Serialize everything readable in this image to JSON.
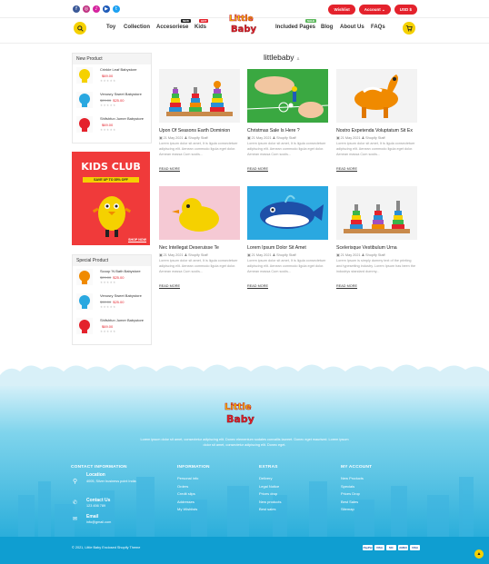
{
  "topbar": {
    "social": [
      {
        "icon": "facebook-icon",
        "glyph": "f",
        "color": "#3b5998"
      },
      {
        "icon": "instagram-icon",
        "glyph": "◎",
        "color": "#c13584"
      },
      {
        "icon": "tiktok-icon",
        "glyph": "♪",
        "color": "#d6249f"
      },
      {
        "icon": "youtube-icon",
        "glyph": "▶",
        "color": "#1e5bb8"
      },
      {
        "icon": "twitter-icon",
        "glyph": "t",
        "color": "#1da1f2"
      }
    ],
    "wishlist": "Wishlist",
    "account": "Account ⌄",
    "currency": "USD $"
  },
  "nav": {
    "toy": "Toy",
    "collection": "Collection",
    "accessories": "Accesoriese",
    "accessories_badge": "NEW",
    "kids": "Kids",
    "kids_badge": "HOT",
    "included_pages": "Included Pages",
    "included_badge": "SALE",
    "blog": "Blog",
    "about": "About Us",
    "faqs": "FAQs",
    "logo_line1": "Little",
    "logo_line2": "Baby",
    "cart_count": "0"
  },
  "sidebar": {
    "new_title": "New Product",
    "new_products": [
      {
        "name": "Crinkle Leaf Babystore",
        "price": "$69.00",
        "old": ""
      },
      {
        "name": "Venosry Sweet Babystore",
        "price": "$25.00",
        "old": "$29.00"
      },
      {
        "name": "Shifshfun Jumer Babystore",
        "price": "$69.00",
        "old": ""
      }
    ],
    "promo": {
      "title": "KIDS CLUB",
      "offer": "SAVE UP TO 35% OFF",
      "cta": "SHOP NOW"
    },
    "special_title": "Special Product",
    "special_products": [
      {
        "name": "Scoop 'N Bath Babystore",
        "price": "$25.00",
        "old": "$29.00"
      },
      {
        "name": "Venosry Sweet Babystore",
        "price": "$25.00",
        "old": "$30.00"
      },
      {
        "name": "Shifshfun Jumer Babystore",
        "price": "$69.00",
        "old": ""
      }
    ],
    "stars": "★★★★★"
  },
  "main": {
    "title": "littlebaby",
    "title_icon": "rss-icon",
    "posts": [
      {
        "title": "Upon Of Seasons Earth Dominion",
        "date": "21 May 2021",
        "author": "Shopify Staff",
        "excerpt": "Lorem ipsum dolor sit amet, It is ligula consectetuer adipiscing elit. Aenean commodo ligula eget dolor. Aenean massa Cum sociis...",
        "more": "READ MORE"
      },
      {
        "title": "Christmas Sale Is Here ?",
        "date": "21 May 2021",
        "author": "Shopify Staff",
        "excerpt": "Lorem ipsum dolor sit amet, It is ligula consectetuer adipiscing elit. Aenean commodo ligula eget dolor. Aenean massa Cum sociis...",
        "more": "READ MORE"
      },
      {
        "title": "Nostro Expetenda Voluptatum Sit Ex",
        "date": "21 May 2021",
        "author": "Shopify Staff",
        "excerpt": "Lorem ipsum dolor sit amet, It is ligula consectetuer adipiscing elit. Aenean commodo ligula eget dolor. Aenean massa Cum sociis...",
        "more": "READ MORE"
      },
      {
        "title": "Nec Intellegat Deseruisse Te",
        "date": "21 May 2021",
        "author": "Shopify Staff",
        "excerpt": "Lorem ipsum dolor sit amet, It is ligula consectetuer adipiscing elit. Aenean commodo ligula eget dolor. Aenean massa Cum sociis...",
        "more": "READ MORE"
      },
      {
        "title": "Lorem Ipsum Dolor Sit Amet",
        "date": "21 May 2021",
        "author": "Shopify Staff",
        "excerpt": "Lorem ipsum dolor sit amet, It is ligula consectetuer adipiscing elit. Aenean commodo ligula eget dolor. Aenean massa Cum sociis...",
        "more": "READ MORE"
      },
      {
        "title": "Scelerisque Vestibulum Urna",
        "date": "21 May 2021",
        "author": "Shopify Staff",
        "excerpt": "Lorem Ipsum is simply dummy text of the printing and typesetting industry. Lorem Ipsum has been the industrys standard dummy...",
        "more": "READ MORE"
      }
    ]
  },
  "footer": {
    "logo_line1": "Little",
    "logo_line2": "Baby",
    "tagline": "Lorem ipsum dolor sit amet, consectetur adipiscing elit. Donec elementum sodales convallis laoreet. Donec eget maurised. Lorem ipsum dolor sit amet, consectetur adipiscing elit. Donec eget.",
    "contact": {
      "heading": "CONTACT INFORMATION",
      "location_label": "Location",
      "location_value": "4005, Silver business point India",
      "phone_label": "Contact Us",
      "phone_value": "123 456 789",
      "email_label": "Email",
      "email_value": "info@gmail.com"
    },
    "information": {
      "heading": "INFORMATION",
      "items": [
        "Personal info",
        "Orders",
        "Credit slips",
        "Addresses",
        "My Wishlists"
      ]
    },
    "extras": {
      "heading": "EXTRAS",
      "items": [
        "Delivery",
        "Legal Notice",
        "Prices drop",
        "New products",
        "Best sales"
      ]
    },
    "account": {
      "heading": "MY ACCOUNT",
      "items": [
        "New Products",
        "Specials",
        "Prices Drop",
        "Best Sales",
        "Sitemap"
      ]
    },
    "copyright": "© 2021, Little Baby Enclosed Shopify Theme",
    "payments": [
      "PayPal",
      "VISA",
      "MC",
      "AMEX",
      "VISA"
    ]
  }
}
